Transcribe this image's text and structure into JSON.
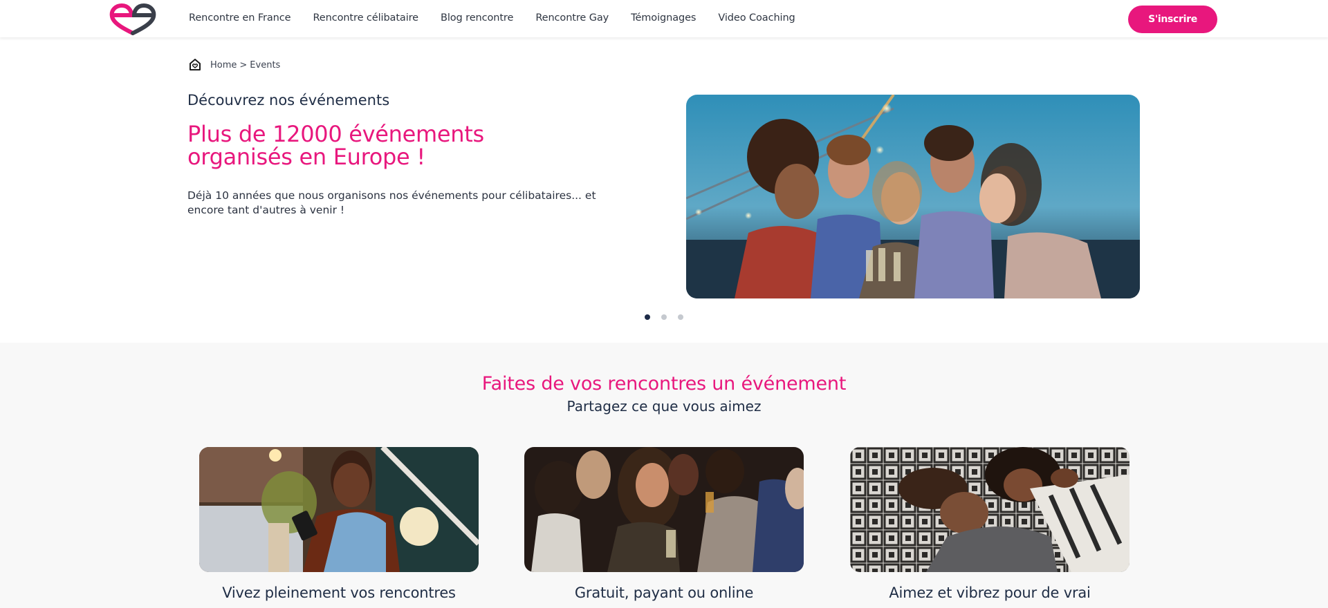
{
  "brand": {
    "accent_color": "#e8177d",
    "dark_color": "#3a3f4a",
    "logo_alt": "logo-ee-heart"
  },
  "nav": {
    "items": [
      {
        "label": "Rencontre en France"
      },
      {
        "label": "Rencontre célibataire"
      },
      {
        "label": "Blog rencontre"
      },
      {
        "label": "Rencontre Gay"
      },
      {
        "label": "Témoignages"
      },
      {
        "label": "Video Coaching"
      }
    ],
    "signup_label": "S'inscrire"
  },
  "breadcrumb": {
    "home_icon": "home-heart-icon",
    "home": "Home",
    "separator": ">",
    "current": "Events"
  },
  "hero": {
    "kicker": "Découvrez nos événements",
    "title": "Plus de 12000 événements organisés en Europe !",
    "description": "Déjà 10 années que nous organisons nos événements pour célibataires... et encore tant d'autres à venir !",
    "carousel": {
      "image_description": "Group of five friends laughing and toasting champagne glasses outdoors at dusk by a river",
      "slides_count": 3,
      "active_slide": 1
    }
  },
  "download_tab": {
    "icon": "download-icon"
  },
  "section": {
    "title": "Faites de vos rencontres un événement",
    "subtitle": "Partagez ce que vous aimez",
    "cards": [
      {
        "title": "Vivez pleinement vos rencontres",
        "image_description": "Smiling woman looking at her phone in a cozy living room"
      },
      {
        "title": "Gratuit, payant ou online",
        "image_description": "People chatting and drinking at a party"
      },
      {
        "title": "Aimez et vibrez pour de vrai",
        "image_description": "Couple lying down laughing on a patterned blanket"
      }
    ]
  }
}
